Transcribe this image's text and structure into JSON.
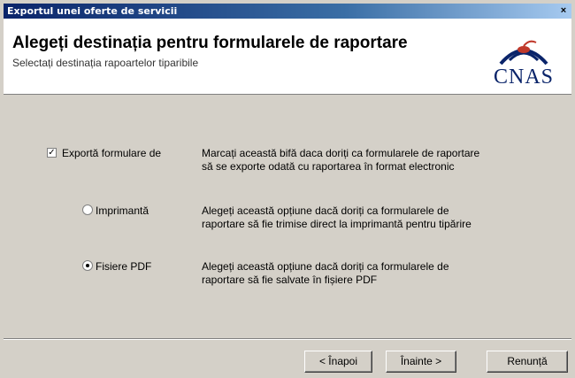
{
  "window": {
    "title": "Exportul unei oferte de servicii"
  },
  "header": {
    "heading": "Alegeți destinația pentru formularele de raportare",
    "subheading": "Selectați destinația rapoartelor tiparibile",
    "logo_text": "CNAS"
  },
  "options": {
    "export_forms": {
      "label": "Exportă formulare de",
      "checked": true,
      "description_1": "Marcați această bifă daca doriți ca formularele de raportare",
      "description_2": "să se exporte odată cu raportarea în format electronic"
    },
    "printer": {
      "label": "Imprimantă",
      "selected": false,
      "description_1": "Alegeți această opțiune dacă doriți ca formularele de",
      "description_2": "raportare să fie trimise direct la imprimantă pentru tipărire"
    },
    "pdf": {
      "label": "Fisiere PDF",
      "selected": true,
      "description_1": "Alegeți această opțiune dacă doriți ca formularele de",
      "description_2": "raportare să fie salvate în fișiere PDF"
    }
  },
  "buttons": {
    "back": "< Înapoi",
    "next": "Înainte >",
    "cancel": "Renunță"
  },
  "colors": {
    "titlebar": "#0a246a",
    "dialog_bg": "#d4d0c8",
    "logo": "#0a246a",
    "logo_accent": "#c0392b"
  }
}
